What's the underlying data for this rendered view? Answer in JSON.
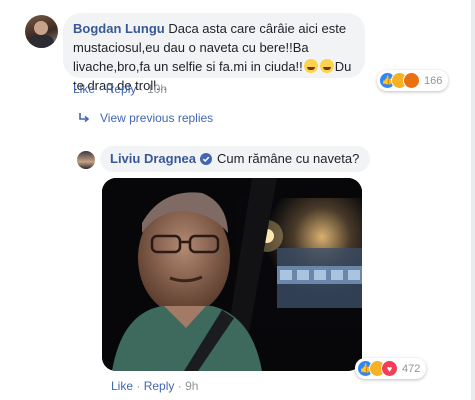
{
  "comment1": {
    "author": "Bogdan Lungu",
    "text_part1": "Daca asta care cârâie aici este mustaciosul,eu dau o naveta cu bere!!Ba livache,bro,fa un selfie si fa.mi in ciuda!!",
    "text_part2": "Du te draq de troll...",
    "reaction_count": "166",
    "actions": {
      "like": "Like",
      "reply": "Reply",
      "time": "10h",
      "sep": "·"
    }
  },
  "view_previous": {
    "label": "View previous replies",
    "icon": "reply-arrow-icon"
  },
  "reply1": {
    "author": "Liviu Dragnea",
    "verified_icon": "verified-badge-icon",
    "text": "Cum rămâne cu naveta?",
    "reaction_count": "472",
    "actions": {
      "like": "Like",
      "reply": "Reply",
      "time": "9h",
      "sep": "·"
    }
  },
  "colors": {
    "link": "#4267b2",
    "name": "#385898",
    "bubble": "#f2f3f5",
    "like_blue": "#2d88ff",
    "haha_yellow": "#f7b125",
    "angry_orange": "#e9710f",
    "love_red": "#f33e58"
  }
}
